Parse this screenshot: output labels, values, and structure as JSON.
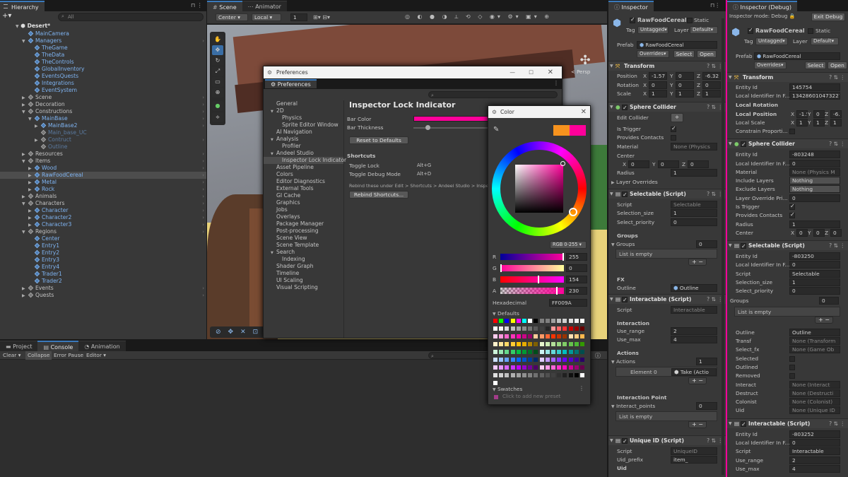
{
  "hierarchy": {
    "tab": "Hierarchy",
    "search_placeholder": "All",
    "scene": "Desert*",
    "items": [
      {
        "label": "MainCamera",
        "indent": 2,
        "blue": true,
        "arrow": false
      },
      {
        "label": "Managers",
        "indent": 2,
        "blue": true,
        "arrow": "open"
      },
      {
        "label": "TheGame",
        "indent": 3,
        "blue": true,
        "arrow": false
      },
      {
        "label": "TheData",
        "indent": 3,
        "blue": true,
        "arrow": false
      },
      {
        "label": "TheControls",
        "indent": 3,
        "blue": true,
        "arrow": false
      },
      {
        "label": "GlobalInventory",
        "indent": 3,
        "blue": true,
        "arrow": false
      },
      {
        "label": "EventsQuests",
        "indent": 3,
        "blue": true,
        "arrow": false
      },
      {
        "label": "Integrations",
        "indent": 3,
        "blue": true,
        "arrow": false
      },
      {
        "label": "EventSystem",
        "indent": 3,
        "blue": true,
        "arrow": false
      },
      {
        "label": "Scene",
        "indent": 2,
        "blue": false,
        "arrow": "closed"
      },
      {
        "label": "Decoration",
        "indent": 2,
        "blue": false,
        "arrow": "closed"
      },
      {
        "label": "Constructions",
        "indent": 2,
        "blue": false,
        "arrow": "open"
      },
      {
        "label": "MainBase",
        "indent": 3,
        "blue": true,
        "arrow": "open"
      },
      {
        "label": "MainBase2",
        "indent": 4,
        "blue": true,
        "arrow": "closed"
      },
      {
        "label": "Main_base_UC",
        "indent": 4,
        "blue": false,
        "dim": true,
        "arrow": false
      },
      {
        "label": "Contruct",
        "indent": 4,
        "blue": false,
        "dim": true,
        "arrow": "closed"
      },
      {
        "label": "Outline",
        "indent": 4,
        "blue": false,
        "dim": true,
        "arrow": false
      },
      {
        "label": "Resources",
        "indent": 2,
        "blue": false,
        "arrow": "closed"
      },
      {
        "label": "Items",
        "indent": 2,
        "blue": false,
        "arrow": "open"
      },
      {
        "label": "Wood",
        "indent": 3,
        "blue": true,
        "arrow": "closed"
      },
      {
        "label": "RawFoodCereal",
        "indent": 3,
        "blue": true,
        "arrow": "closed",
        "selected": true
      },
      {
        "label": "Metal",
        "indent": 3,
        "blue": true,
        "arrow": "closed"
      },
      {
        "label": "Rock",
        "indent": 3,
        "blue": true,
        "arrow": "closed"
      },
      {
        "label": "Animals",
        "indent": 2,
        "blue": false,
        "arrow": "closed"
      },
      {
        "label": "Characters",
        "indent": 2,
        "blue": false,
        "arrow": "open"
      },
      {
        "label": "Character",
        "indent": 3,
        "blue": true,
        "arrow": "closed"
      },
      {
        "label": "Character2",
        "indent": 3,
        "blue": true,
        "arrow": "closed"
      },
      {
        "label": "Character3",
        "indent": 3,
        "blue": true,
        "arrow": "closed"
      },
      {
        "label": "Regions",
        "indent": 2,
        "blue": false,
        "arrow": "open"
      },
      {
        "label": "Center",
        "indent": 3,
        "blue": true,
        "arrow": false
      },
      {
        "label": "Entry1",
        "indent": 3,
        "blue": true,
        "arrow": false
      },
      {
        "label": "Entry2",
        "indent": 3,
        "blue": true,
        "arrow": false
      },
      {
        "label": "Entry3",
        "indent": 3,
        "blue": true,
        "arrow": false
      },
      {
        "label": "Entry4",
        "indent": 3,
        "blue": true,
        "arrow": false
      },
      {
        "label": "Trader1",
        "indent": 3,
        "blue": true,
        "arrow": false
      },
      {
        "label": "Trader2",
        "indent": 3,
        "blue": true,
        "arrow": false
      },
      {
        "label": "Events",
        "indent": 2,
        "blue": false,
        "arrow": "closed"
      },
      {
        "label": "Quests",
        "indent": 2,
        "blue": false,
        "arrow": "closed"
      }
    ]
  },
  "scene_tabs": {
    "scene": "Scene",
    "animator": "Animator"
  },
  "scene_toolbar": {
    "pivot": "Center",
    "space": "Local",
    "snap": "1"
  },
  "scene_view": {
    "persp": "< Persp"
  },
  "console": {
    "tabs": [
      "Project",
      "Console",
      "Animation"
    ],
    "clear": "Clear",
    "collapse": "Collapse",
    "error_pause": "Error Pause",
    "editor": "Editor"
  },
  "preferences": {
    "title": "Preferences",
    "tab": "Preferences",
    "heading": "Inspector Lock Indicator",
    "nav": [
      {
        "label": "General",
        "indent": 0
      },
      {
        "label": "2D",
        "indent": 0
      },
      {
        "label": "Physics",
        "indent": 1
      },
      {
        "label": "Sprite Editor Window",
        "indent": 1
      },
      {
        "label": "AI Navigation",
        "indent": 0
      },
      {
        "label": "Analysis",
        "indent": 0
      },
      {
        "label": "Profiler",
        "indent": 1
      },
      {
        "label": "Andeel Studio",
        "indent": 0
      },
      {
        "label": "Inspector Lock Indicator",
        "indent": 1,
        "selected": true
      },
      {
        "label": "Asset Pipeline",
        "indent": 0
      },
      {
        "label": "Colors",
        "indent": 0
      },
      {
        "label": "Editor Diagnostics",
        "indent": 0
      },
      {
        "label": "External Tools",
        "indent": 0
      },
      {
        "label": "GI Cache",
        "indent": 0
      },
      {
        "label": "Graphics",
        "indent": 0
      },
      {
        "label": "Jobs",
        "indent": 0
      },
      {
        "label": "Overlays",
        "indent": 0
      },
      {
        "label": "Package Manager",
        "indent": 0
      },
      {
        "label": "Post-processing",
        "indent": 0
      },
      {
        "label": "Scene View",
        "indent": 0
      },
      {
        "label": "Scene Template",
        "indent": 0
      },
      {
        "label": "Search",
        "indent": 0
      },
      {
        "label": "Indexing",
        "indent": 1
      },
      {
        "label": "Shader Graph",
        "indent": 0
      },
      {
        "label": "Timeline",
        "indent": 0
      },
      {
        "label": "UI Scaling",
        "indent": 0
      },
      {
        "label": "Visual Scripting",
        "indent": 0
      }
    ],
    "bar_color": "Bar Color",
    "bar_thickness": "Bar Thickness",
    "reset": "Reset to Defaults",
    "shortcuts": "Shortcuts",
    "toggle_lock": "Toggle Lock",
    "toggle_lock_key": "Alt+G",
    "toggle_debug": "Toggle Debug Mode",
    "toggle_debug_key": "Alt+D",
    "rebind_note": "Rebind these under Edit > Shortcuts > Andeel Studio > Inspector L",
    "rebind_btn": "Rebind Shortcuts..."
  },
  "color_picker": {
    "title": "Color",
    "mode": "RGB 0-255",
    "r": "255",
    "g": "0",
    "b": "154",
    "a": "230",
    "r_fill": 1.0,
    "g_fill": 0.0,
    "b_fill": 0.6,
    "a_fill": 0.9,
    "hex_label": "Hexadecimal",
    "hex": "FF009A",
    "defaults": "Defaults",
    "swatches": "Swatches",
    "add_preset": "Click to add new preset",
    "old_color": "#f7931e",
    "new_color": "#ff009a"
  },
  "inspector": {
    "tab": "Inspector",
    "object": "RawFoodCereal",
    "static": "Static",
    "tag_label": "Tag",
    "tag": "Untagged",
    "layer_label": "Layer",
    "layer": "Default",
    "prefab_label": "Prefab",
    "prefab": "RawFoodCereal",
    "overrides": "Overrides",
    "select": "Select",
    "open": "Open",
    "transform": "Transform",
    "position": "Position",
    "rotation": "Rotation",
    "scale": "Scale",
    "pos": [
      "-1.57",
      "0",
      "-6.32"
    ],
    "rot": [
      "0",
      "0",
      "0"
    ],
    "scl": [
      "1",
      "1",
      "1"
    ],
    "sphere": "Sphere Collider",
    "edit_collider": "Edit Collider",
    "is_trigger": "Is Trigger",
    "provides_contacts": "Provides Contacts",
    "material": "Material",
    "material_val": "None (Physics",
    "center": "Center",
    "center_vals": [
      "0",
      "0",
      "0"
    ],
    "radius": "Radius",
    "radius_val": "1",
    "layer_overrides": "Layer Overrides",
    "selectable": "Selectable (Script)",
    "script": "Script",
    "selectable_script": "Selectable",
    "selection_size": "Selection_size",
    "selection_size_val": "1",
    "select_priority": "Select_priority",
    "select_priority_val": "0",
    "groups": "Groups",
    "groups_count": "0",
    "list_empty": "List is empty",
    "fx": "FX",
    "outline": "Outline",
    "outline_val": "Outline",
    "interactable": "Interactable (Script)",
    "interactable_script": "Interactable",
    "interaction": "Interaction",
    "use_range": "Use_range",
    "use_range_val": "2",
    "use_max": "Use_max",
    "use_max_val": "4",
    "actions": "Actions",
    "actions_count": "1",
    "element0": "Element 0",
    "take_action": "Take (Actio",
    "interaction_point": "Interaction Point",
    "interact_points": "Interact_points",
    "interact_points_count": "0",
    "uniqueid": "Unique ID (Script)",
    "uniqueid_script": "UniqueID",
    "uid_prefix": "Uid_prefix",
    "uid_prefix_val": "item_",
    "uid": "Uid",
    "axes": [
      "X",
      "Y",
      "Z"
    ]
  },
  "debug": {
    "tab": "Inspector (Debug)",
    "mode": "Inspector mode: Debug",
    "exit": "Exit Debug",
    "object": "RawFoodCereal",
    "static": "Static",
    "tag": "Untagged",
    "layer": "Default",
    "prefab": "RawFoodCereal",
    "transform": "Transform",
    "entity_id": "Entity Id",
    "entity_val1": "145754",
    "local_identifier": "Local Identifier In F...",
    "local_id_val": "134286010473227",
    "local_rotation": "Local Rotation",
    "local_position": "Local Position",
    "local_scale": "Local Scale",
    "lp": [
      "-1.5",
      "0",
      "-6."
    ],
    "ls": [
      "1",
      "1",
      "1"
    ],
    "constrain": "Constrain Proporti...",
    "sphere": "Sphere Collider",
    "entity_val2": "-803248",
    "local_id2": "0",
    "material": "Material",
    "material_val": "None (Physics M",
    "include": "Include Layers",
    "include_val": "Nothing",
    "exclude": "Exclude Layers",
    "exclude_val": "Nothing",
    "layer_override": "Layer Override Pri...",
    "layer_override_val": "0",
    "is_trigger": "Is Trigger",
    "provides_contacts": "Provides Contacts",
    "radius": "Radius",
    "radius_val": "1",
    "center": "Center",
    "center_vals": [
      "0",
      "0",
      "0"
    ],
    "selectable": "Selectable (Script)",
    "entity_val3": "-803250",
    "local_id3": "0",
    "script": "Script",
    "selectable_script": "Selectable",
    "selection_size": "Selection_size",
    "selection_size_val": "1",
    "select_priority": "Select_priority",
    "select_priority_val": "0",
    "groups": "Groups",
    "groups_count": "0",
    "list_empty": "List is empty",
    "outline": "Outline",
    "outline_val": "Outline",
    "transf": "Transf",
    "transf_val": "None (Transform",
    "select_fx": "Select_fx",
    "select_fx_val": "None (Game Ob",
    "selected": "Selected",
    "outlined": "Outlined",
    "removed": "Removed",
    "interact": "Interact",
    "interact_val": "None (Interact",
    "destruct": "Destruct",
    "destruct_val": "None (Destructi",
    "colonist": "Colonist",
    "colonist_val": "None (Colonist)",
    "uid": "Uid",
    "uid_val": "None (Unique ID",
    "interactable": "Interactable (Script)",
    "entity_val4": "-803252",
    "local_id4": "0",
    "interactable_script": "Interactable",
    "use_range": "Use_range",
    "use_range_val": "2",
    "use_max": "Use_max",
    "use_max_val": "4"
  },
  "colors": {
    "accent": "#3a79bb",
    "selection": "#2c5d87",
    "bar": "#ff009a"
  }
}
